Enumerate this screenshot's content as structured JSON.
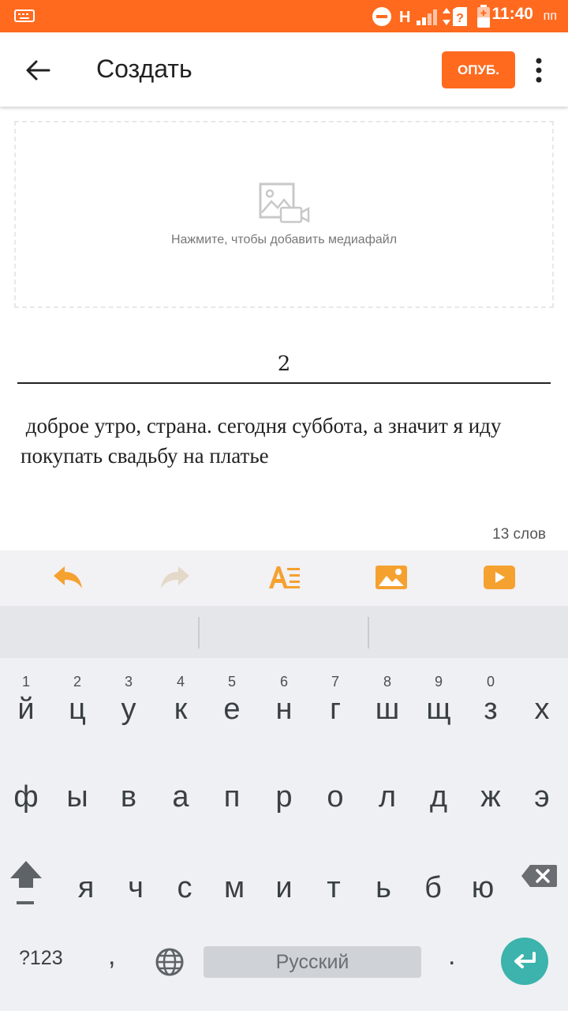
{
  "status_bar": {
    "network_label": "H",
    "time": "11:40",
    "ampm": "пп"
  },
  "app_bar": {
    "title": "Создать",
    "publish_label": "ОПУБ."
  },
  "media": {
    "hint": "Нажмите, чтобы добавить медиафайл"
  },
  "editor": {
    "title_value": "2",
    "body_text": " доброе утро, страна. сегодня суббота, а значит я иду покупать свадьбу на платье",
    "word_count": "13 слов"
  },
  "toolbar": {
    "icons": [
      "undo-icon",
      "redo-icon",
      "text-format-icon",
      "image-icon",
      "video-icon"
    ]
  },
  "colors": {
    "accent": "#ff6a1f",
    "enter": "#3cb3ac"
  },
  "keyboard": {
    "row1": [
      {
        "key": "й",
        "hint": "1"
      },
      {
        "key": "ц",
        "hint": "2"
      },
      {
        "key": "у",
        "hint": "3"
      },
      {
        "key": "к",
        "hint": "4"
      },
      {
        "key": "е",
        "hint": "5"
      },
      {
        "key": "н",
        "hint": "6"
      },
      {
        "key": "г",
        "hint": "7"
      },
      {
        "key": "ш",
        "hint": "8"
      },
      {
        "key": "щ",
        "hint": "9"
      },
      {
        "key": "з",
        "hint": "0"
      },
      {
        "key": "х",
        "hint": ""
      }
    ],
    "row2": [
      "ф",
      "ы",
      "в",
      "а",
      "п",
      "р",
      "о",
      "л",
      "д",
      "ж",
      "э"
    ],
    "row3": [
      "я",
      "ч",
      "с",
      "м",
      "и",
      "т",
      "ь",
      "б",
      "ю"
    ],
    "symbols_label": "?123",
    "comma": ",",
    "period": ".",
    "space_label": "Русский"
  }
}
